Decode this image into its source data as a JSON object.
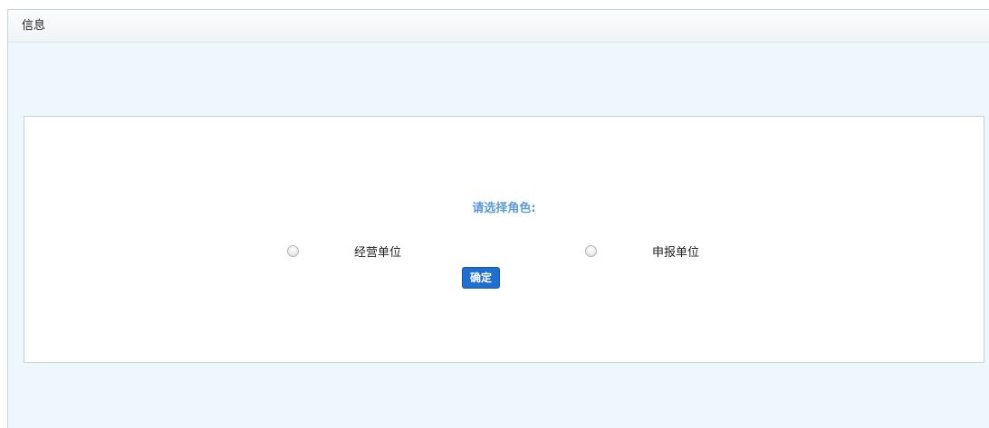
{
  "window": {
    "title": "信息"
  },
  "role_form": {
    "prompt": "请选择角色:",
    "options": [
      {
        "label": "经营单位",
        "selected": false
      },
      {
        "label": "申报单位",
        "selected": false
      }
    ],
    "confirm_label": "确定"
  },
  "colors": {
    "prompt_text": "#5b9bd5",
    "button_bg": "#1f6fd1",
    "content_bg": "#eef8fc"
  }
}
